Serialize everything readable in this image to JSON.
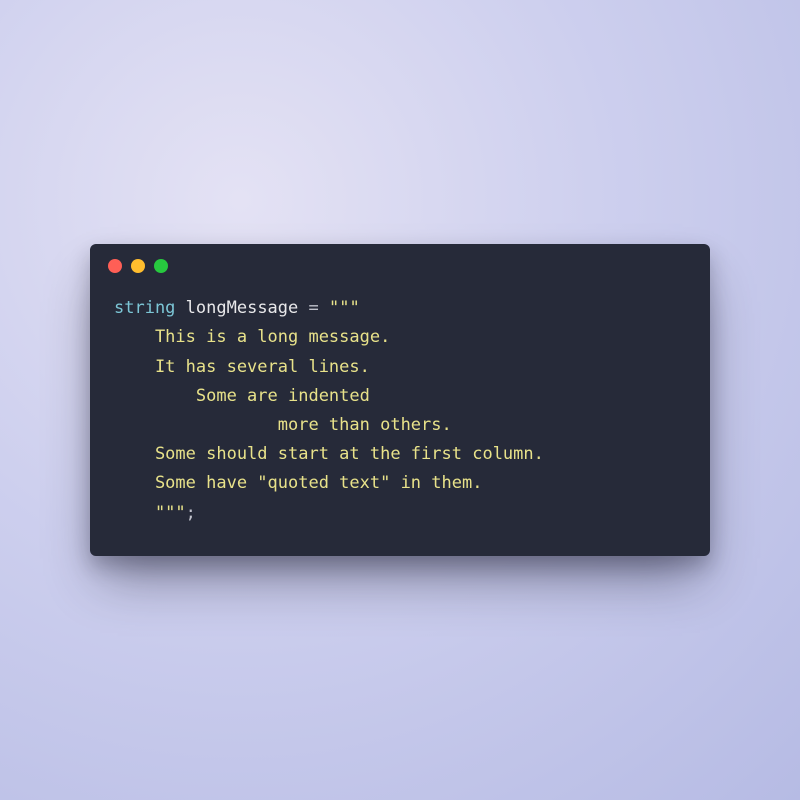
{
  "window": {
    "traffic_lights": [
      "close",
      "minimize",
      "zoom"
    ]
  },
  "code": {
    "keyword": "string",
    "identifier": "longMessage",
    "operator": "=",
    "string_open": "\"\"\"",
    "body_line1": "    This is a long message.",
    "body_line2": "    It has several lines.",
    "body_line3": "        Some are indented",
    "body_line4": "                more than others.",
    "body_line5": "    Some should start at the first column.",
    "body_line6": "    Some have \"quoted text\" in them.",
    "string_close": "    \"\"\"",
    "terminator": ";"
  }
}
